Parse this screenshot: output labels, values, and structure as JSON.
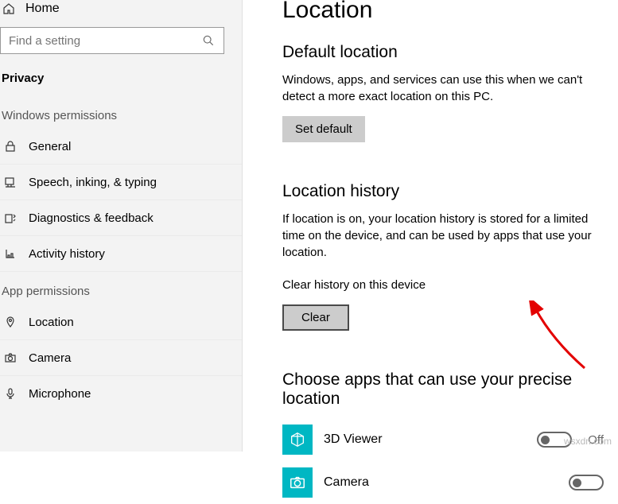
{
  "sidebar": {
    "home": "Home",
    "search_placeholder": "Find a setting",
    "title": "Privacy",
    "groups": [
      {
        "label": "Windows permissions",
        "items": [
          {
            "icon": "lock",
            "label": "General"
          },
          {
            "icon": "speech",
            "label": "Speech, inking, & typing"
          },
          {
            "icon": "diagnostics",
            "label": "Diagnostics & feedback"
          },
          {
            "icon": "activity",
            "label": "Activity history"
          }
        ]
      },
      {
        "label": "App permissions",
        "items": [
          {
            "icon": "location",
            "label": "Location"
          },
          {
            "icon": "camera",
            "label": "Camera"
          },
          {
            "icon": "microphone",
            "label": "Microphone"
          }
        ]
      }
    ]
  },
  "content": {
    "page_title": "Location",
    "default_location": {
      "heading": "Default location",
      "desc": "Windows, apps, and services can use this when we can't detect a more exact location on this PC.",
      "button": "Set default"
    },
    "history": {
      "heading": "Location history",
      "desc": "If location is on, your location history is stored for a limited time on the device, and can be used by apps that use your location.",
      "clear_label": "Clear history on this device",
      "clear_button": "Clear"
    },
    "apps": {
      "heading": "Choose apps that can use your precise location",
      "items": [
        {
          "name": "3D Viewer",
          "state": "Off"
        },
        {
          "name": "Camera",
          "state": ""
        }
      ]
    }
  },
  "watermark": "wsxdn.com"
}
